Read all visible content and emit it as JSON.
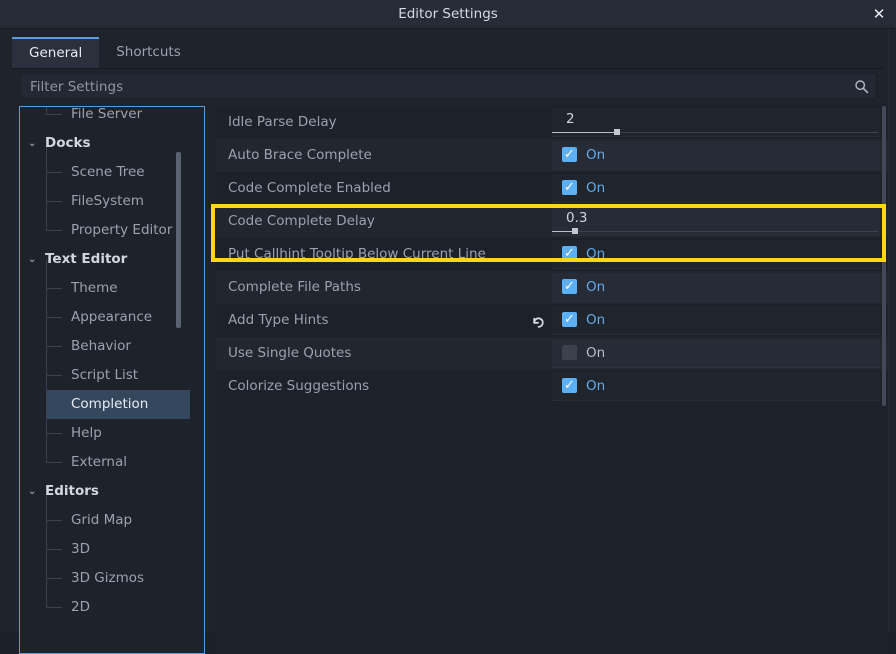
{
  "window": {
    "title": "Editor Settings",
    "close_label": "✕"
  },
  "tabs": [
    {
      "label": "General",
      "active": true
    },
    {
      "label": "Shortcuts",
      "active": false
    }
  ],
  "search": {
    "placeholder": "Filter Settings",
    "value": "",
    "icon": "search-icon"
  },
  "colors": {
    "accent_blue": "#5a9bdd",
    "checkbox_blue": "#5cb0f5",
    "on_label_blue": "#64a9e8",
    "highlight_yellow": "#ffd715",
    "selection_bg": "#35475c",
    "panel_bg": "#1d212a",
    "window_bg": "#1f232b"
  },
  "tree": {
    "items": [
      {
        "label": "File Server",
        "indent": 2,
        "type": "leaf",
        "selected": false,
        "clipped_top": true
      },
      {
        "label": "Docks",
        "indent": 1,
        "type": "category",
        "selected": false,
        "expanded": true
      },
      {
        "label": "Scene Tree",
        "indent": 2,
        "type": "leaf",
        "selected": false
      },
      {
        "label": "FileSystem",
        "indent": 2,
        "type": "leaf",
        "selected": false
      },
      {
        "label": "Property Editor",
        "indent": 2,
        "type": "leaf",
        "selected": false
      },
      {
        "label": "Text Editor",
        "indent": 1,
        "type": "category",
        "selected": false,
        "expanded": true
      },
      {
        "label": "Theme",
        "indent": 2,
        "type": "leaf",
        "selected": false
      },
      {
        "label": "Appearance",
        "indent": 2,
        "type": "leaf",
        "selected": false
      },
      {
        "label": "Behavior",
        "indent": 2,
        "type": "leaf",
        "selected": false
      },
      {
        "label": "Script List",
        "indent": 2,
        "type": "leaf",
        "selected": false
      },
      {
        "label": "Completion",
        "indent": 2,
        "type": "leaf",
        "selected": true
      },
      {
        "label": "Help",
        "indent": 2,
        "type": "leaf",
        "selected": false
      },
      {
        "label": "External",
        "indent": 2,
        "type": "leaf",
        "selected": false
      },
      {
        "label": "Editors",
        "indent": 1,
        "type": "category",
        "selected": false,
        "expanded": true
      },
      {
        "label": "Grid Map",
        "indent": 2,
        "type": "leaf",
        "selected": false
      },
      {
        "label": "3D",
        "indent": 2,
        "type": "leaf",
        "selected": false
      },
      {
        "label": "3D Gizmos",
        "indent": 2,
        "type": "leaf",
        "selected": false
      },
      {
        "label": "2D",
        "indent": 2,
        "type": "leaf",
        "selected": false
      }
    ],
    "expand_arrow_glyph": "⌄"
  },
  "settings": {
    "rows": [
      {
        "name": "Idle Parse Delay",
        "control": "slider",
        "value": "2",
        "fill_pct": 20,
        "has_revert": false,
        "highlighted": false
      },
      {
        "name": "Auto Brace Complete",
        "control": "checkbox",
        "value": "On",
        "checked": true,
        "has_revert": false,
        "highlighted": false
      },
      {
        "name": "Code Complete Enabled",
        "control": "checkbox",
        "value": "On",
        "checked": true,
        "has_revert": false,
        "highlighted": false
      },
      {
        "name": "Code Complete Delay",
        "control": "slider",
        "value": "0.3",
        "fill_pct": 7,
        "has_revert": false,
        "highlighted": true
      },
      {
        "name": "Put Callhint Tooltip Below Current Line",
        "control": "checkbox",
        "value": "On",
        "checked": true,
        "has_revert": false,
        "highlighted": false
      },
      {
        "name": "Complete File Paths",
        "control": "checkbox",
        "value": "On",
        "checked": true,
        "has_revert": false,
        "highlighted": false
      },
      {
        "name": "Add Type Hints",
        "control": "checkbox",
        "value": "On",
        "checked": true,
        "has_revert": true,
        "revert_icon": "revert-arrow-icon",
        "highlighted": false
      },
      {
        "name": "Use Single Quotes",
        "control": "checkbox",
        "value": "On",
        "checked": false,
        "has_revert": false,
        "highlighted": false
      },
      {
        "name": "Colorize Suggestions",
        "control": "checkbox",
        "value": "On",
        "checked": true,
        "has_revert": false,
        "highlighted": false
      }
    ]
  },
  "annotation": {
    "target_row": "Code Complete Delay",
    "color": "#ffd715"
  }
}
